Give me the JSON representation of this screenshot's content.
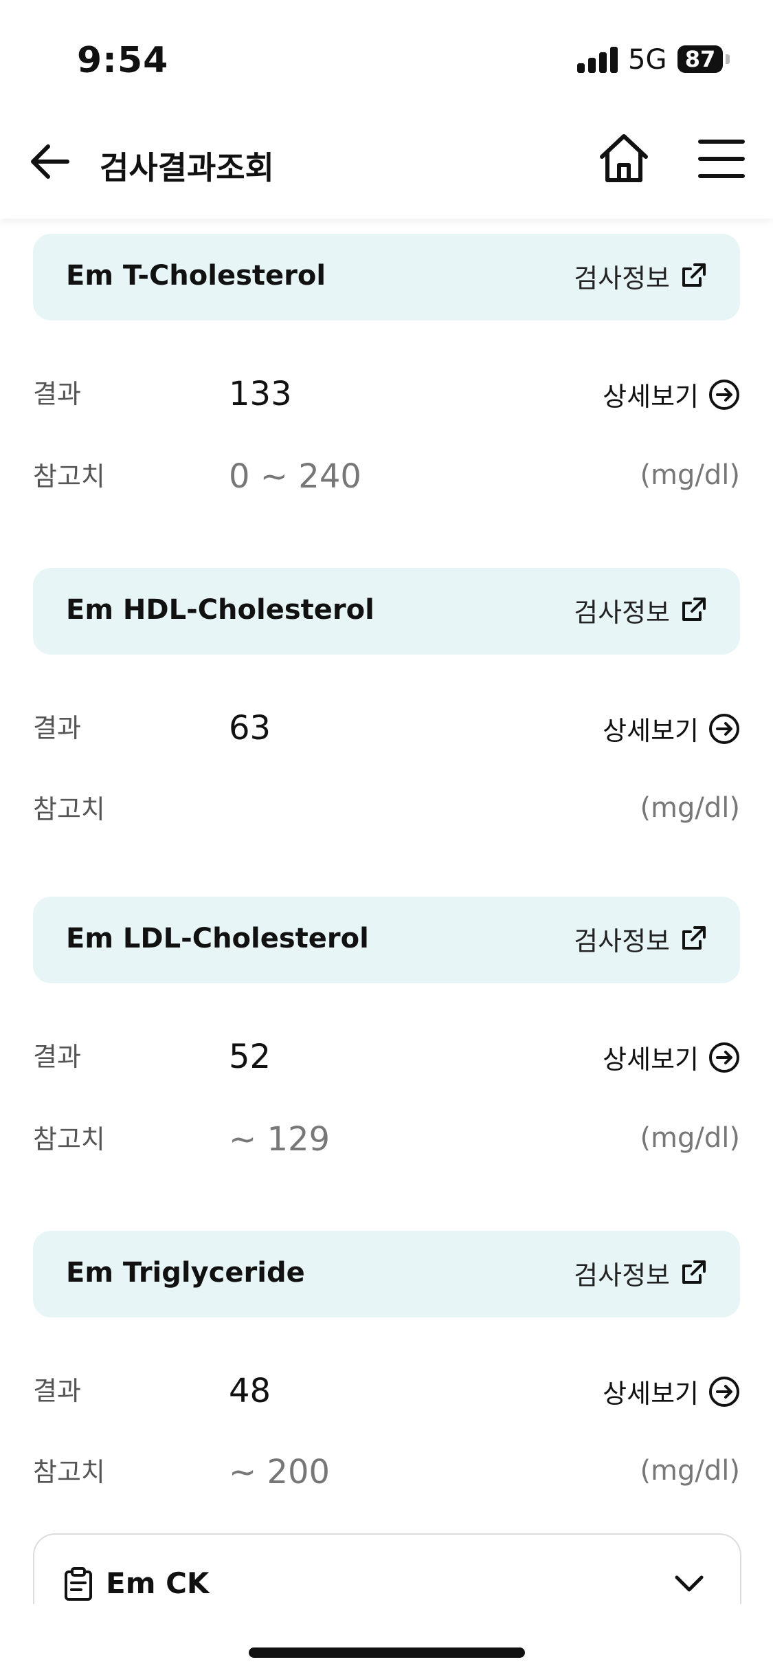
{
  "status_bar": {
    "time": "9:54",
    "network": "5G",
    "battery": "87"
  },
  "header": {
    "title": "검사결과조회",
    "back_icon": "arrow-left-icon",
    "home_icon": "home-icon",
    "menu_icon": "hamburger-menu-icon"
  },
  "labels": {
    "result": "결과",
    "reference": "참고치",
    "detail": "상세보기",
    "info": "검사정보"
  },
  "tests": [
    {
      "name": "Em T-Cholesterol",
      "result": "133",
      "reference": "0 ~ 240",
      "unit": "(mg/dl)"
    },
    {
      "name": "Em HDL-Cholesterol",
      "result": "63",
      "reference": "",
      "unit": "(mg/dl)"
    },
    {
      "name": "Em LDL-Cholesterol",
      "result": "52",
      "reference": "~ 129",
      "unit": "(mg/dl)"
    },
    {
      "name": "Em Triglyceride",
      "result": "48",
      "reference": "~ 200",
      "unit": "(mg/dl)"
    }
  ],
  "collapsed_card": {
    "title": "Em CK",
    "icon": "clipboard-icon",
    "toggle_icon": "chevron-down-icon"
  },
  "colors": {
    "section_header_bg": "#e8f5f6",
    "muted_text": "#777777"
  }
}
